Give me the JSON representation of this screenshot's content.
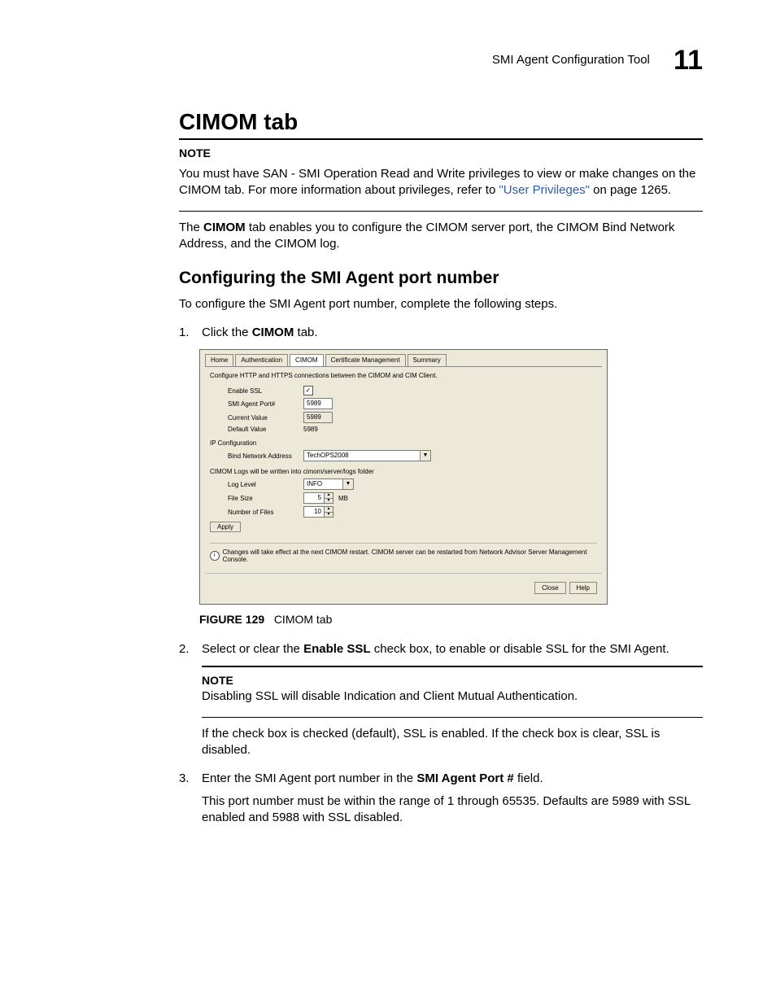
{
  "header": {
    "title": "SMI Agent Configuration Tool",
    "chapter": "11"
  },
  "h1": "CIMOM tab",
  "note1": {
    "label": "NOTE",
    "text_a": "You must have SAN - SMI Operation Read and Write privileges to view or make changes on the CIMOM tab. For more information about privileges, refer to ",
    "link": "\"User Privileges\"",
    "text_b": " on page 1265."
  },
  "intro": {
    "a": "The ",
    "b": "CIMOM",
    "c": " tab enables you to configure the CIMOM server port, the CIMOM Bind Network Address, and the CIMOM log."
  },
  "h2": "Configuring the SMI Agent port number",
  "lead": "To configure the SMI Agent port number, complete the following steps.",
  "step1": {
    "num": "1.",
    "a": "Click the ",
    "b": "CIMOM",
    "c": " tab."
  },
  "panel": {
    "tabs": [
      "Home",
      "Authentication",
      "CIMOM",
      "Certificate Management",
      "Summary"
    ],
    "desc": "Configure HTTP and HTTPS connections between the CIMOM and CIM Client.",
    "rows": {
      "enable_ssl": "Enable SSL",
      "port_label": "SMI Agent Port#",
      "port_value": "5989",
      "current_label": "Current Value",
      "current_value": "5989",
      "default_label": "Default Value",
      "default_value": "5989"
    },
    "ipconf": "IP Configuration",
    "bind_label": "Bind Network Address",
    "bind_value": "TechOPS2008",
    "logs_text": "CIMOM Logs will be written into cimom/server/logs folder",
    "log_level_label": "Log Level",
    "log_level_value": "INFO",
    "file_size_label": "File Size",
    "file_size_value": "5",
    "file_size_unit": "MB",
    "num_files_label": "Number of Files",
    "num_files_value": "10",
    "apply": "Apply",
    "info": "Changes will take effect at the next CIMOM restart. CIMOM server can be restarted from Network Advisor Server Management Console.",
    "close": "Close",
    "help": "Help"
  },
  "figure": {
    "label": "FIGURE 129",
    "caption": "CIMOM tab"
  },
  "step2": {
    "num": "2.",
    "a": "Select or clear the ",
    "b": "Enable SSL",
    "c": " check box, to enable or disable SSL for the SMI Agent."
  },
  "note2": {
    "label": "NOTE",
    "text": "Disabling SSL will disable Indication and Client Mutual Authentication."
  },
  "after_note2": "If the check box is checked (default), SSL is enabled. If the check box is clear, SSL is disabled.",
  "step3": {
    "num": "3.",
    "a": "Enter the SMI Agent port number in the ",
    "b": "SMI Agent Port #",
    "c": " field.",
    "p2": "This port number must be within the range of 1 through 65535. Defaults are 5989 with SSL enabled and 5988 with SSL disabled."
  }
}
